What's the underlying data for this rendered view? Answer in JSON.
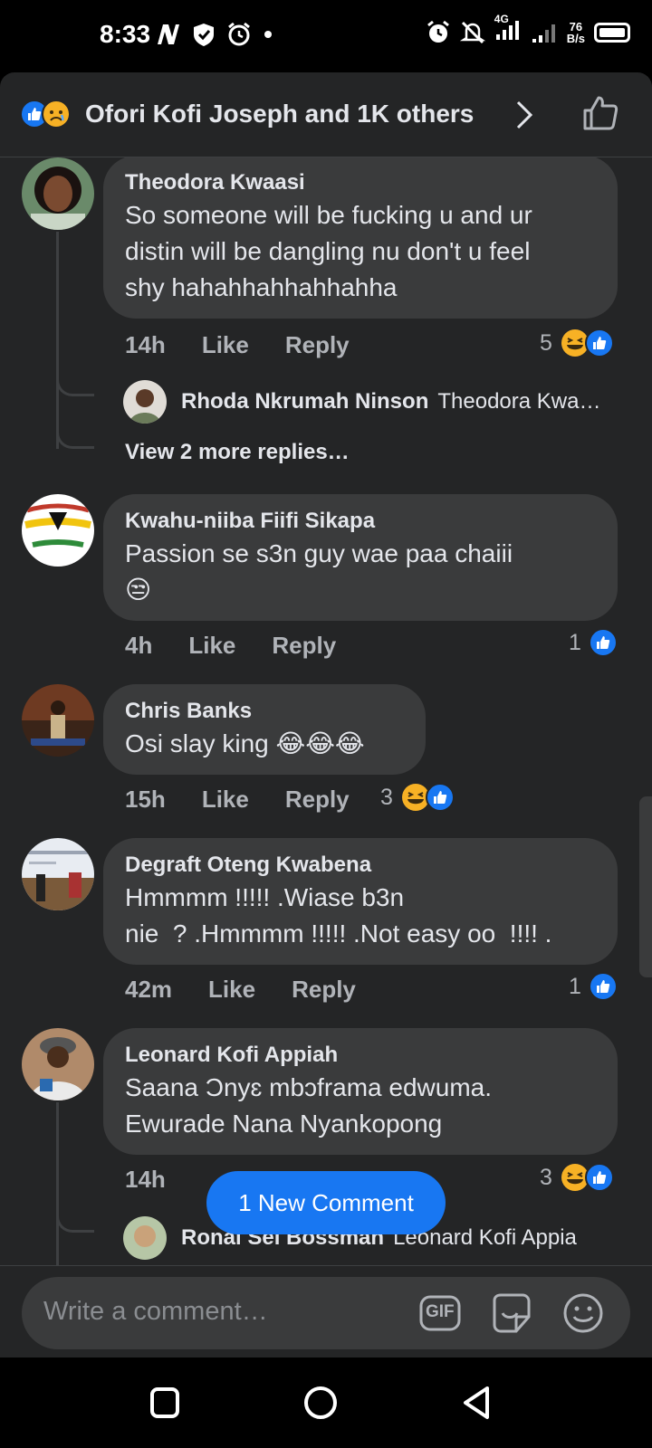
{
  "status_bar": {
    "time": "8:33",
    "network": "4G",
    "speed_value": "76",
    "speed_unit": "B/s"
  },
  "header": {
    "reactions_text": "Ofori Kofi Joseph and 1K others"
  },
  "comments": [
    {
      "name": "Theodora Kwaasi",
      "text_lines": [
        "So someone will be fucking u and ur",
        "distin will be dangling nu don't u feel",
        "shy hahahhahhahhahha"
      ],
      "time": "14h",
      "like": "Like",
      "reply": "Reply",
      "reaction_count": "5",
      "reply_author": "Rhoda Nkrumah Ninson",
      "reply_preview": "Theodora Kwa…",
      "view_more": "View 2 more replies…"
    },
    {
      "name": "Kwahu-niiba Fiifi Sikapa",
      "text_lines": [
        "Passion se s3n guy wae paa chaiii",
        "😒"
      ],
      "time": "4h",
      "like": "Like",
      "reply": "Reply",
      "reaction_count": "1"
    },
    {
      "name": "Chris Banks",
      "text_lines": [
        "Osi slay king 😂😂😂"
      ],
      "time": "15h",
      "like": "Like",
      "reply": "Reply",
      "reaction_count": "3"
    },
    {
      "name": "Degraft Oteng Kwabena",
      "text_lines": [
        "Hmmmm !!!!! .Wiase b3n",
        "nie  ? .Hmmmm !!!!! .Not easy oo  !!!! ."
      ],
      "time": "42m",
      "like": "Like",
      "reply": "Reply",
      "reaction_count": "1"
    },
    {
      "name": "Leonard Kofi Appiah",
      "text_lines": [
        "Saana Ɔnyɛ mbɔframa edwuma.",
        "Ewurade Nana Nyankopong"
      ],
      "time": "14h",
      "reaction_count": "3",
      "reply_author": "Ronal Sei Bossman",
      "reply_preview": "Leonard Kofi Appia"
    }
  ],
  "new_comment_pill": "1 New Comment",
  "composer": {
    "placeholder": "Write a comment…",
    "gif_label": "GIF"
  },
  "colors": {
    "accent": "#1877f2",
    "bubble": "#3a3b3c",
    "sheet": "#242526"
  }
}
